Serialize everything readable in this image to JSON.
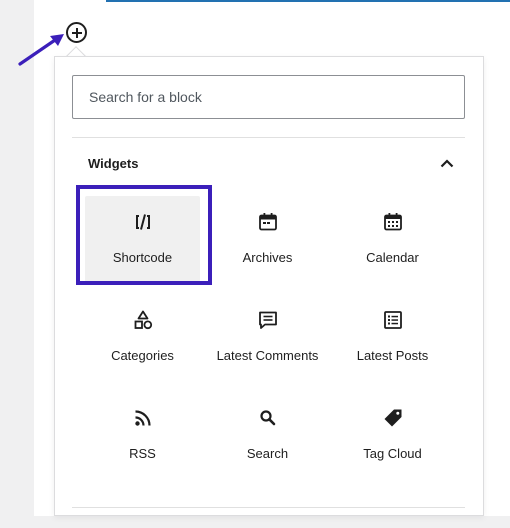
{
  "search": {
    "placeholder": "Search for a block"
  },
  "panel": {
    "title": "Widgets",
    "collapse_icon": "chevron-up-icon"
  },
  "blocks": [
    {
      "label": "Shortcode",
      "icon": "shortcode-icon"
    },
    {
      "label": "Archives",
      "icon": "archives-icon"
    },
    {
      "label": "Calendar",
      "icon": "calendar-icon"
    },
    {
      "label": "Categories",
      "icon": "categories-icon"
    },
    {
      "label": "Latest Comments",
      "icon": "comment-icon"
    },
    {
      "label": "Latest Posts",
      "icon": "list-icon"
    },
    {
      "label": "RSS",
      "icon": "rss-icon"
    },
    {
      "label": "Search",
      "icon": "search-icon"
    },
    {
      "label": "Tag Cloud",
      "icon": "tag-icon"
    }
  ],
  "annotation": {
    "highlighted_block": "Shortcode",
    "highlight_color": "#3b1fba",
    "arrow_color": "#3b1fba",
    "arrow_target": "inserter-plus-icon"
  },
  "colors": {
    "editor_background": "#f0f0f1",
    "accent_line": "#2271b1",
    "text": "#1e1e1e"
  }
}
